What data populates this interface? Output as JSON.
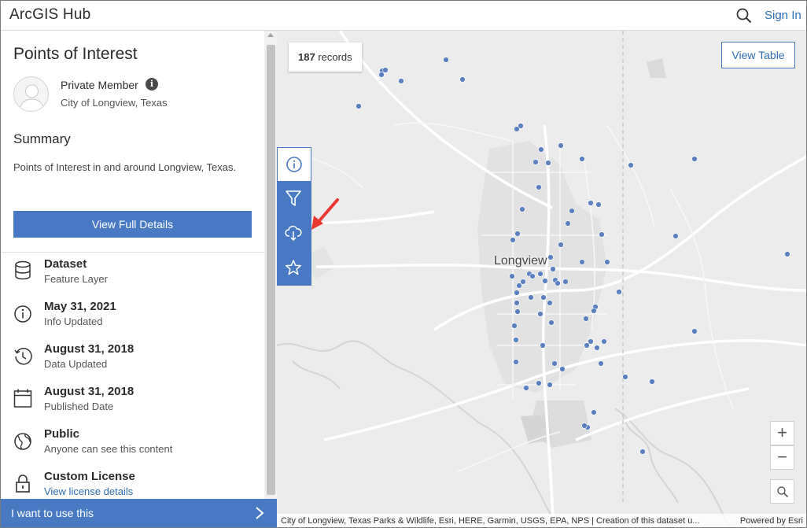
{
  "header": {
    "app_title": "ArcGIS Hub",
    "search_icon": "search-icon",
    "signin_label": "Sign In"
  },
  "panel": {
    "title": "Points of Interest",
    "owner": {
      "name": "Private Member",
      "organization": "City of Longview, Texas"
    },
    "summary_heading": "Summary",
    "summary_text": "Points of Interest in and around Longview, Texas.",
    "view_details_label": "View Full Details",
    "meta": [
      {
        "icon": "database-icon",
        "title": "Dataset",
        "subtitle": "Feature Layer"
      },
      {
        "icon": "info-circle-icon",
        "title": "May 31, 2021",
        "subtitle": "Info Updated"
      },
      {
        "icon": "history-icon",
        "title": "August 31, 2018",
        "subtitle": "Data Updated"
      },
      {
        "icon": "calendar-icon",
        "title": "August 31, 2018",
        "subtitle": "Published Date"
      },
      {
        "icon": "globe-icon",
        "title": "Public",
        "subtitle": "Anyone can see this content"
      },
      {
        "icon": "lock-icon",
        "title": "Custom License",
        "subtitle": "View license details"
      }
    ],
    "use_bar_label": "I want to use this"
  },
  "map": {
    "records_count": "187",
    "records_suffix": " records",
    "view_table_label": "View Table",
    "city_label": "Longview",
    "zoom_in_label": "+",
    "zoom_out_label": "−",
    "attribution": "City of Longview, Texas Parks & Wildlife, Esri, HERE, Garmin, USGS, EPA, NPS | Creation of this dataset u...",
    "powered_by": "Powered by Esri",
    "point_color": "#5a80c2",
    "toolbar": [
      "info-icon",
      "filter-icon",
      "download-icon",
      "star-icon"
    ]
  },
  "colors": {
    "accent": "#4a79c4",
    "link": "#2d6db5",
    "annotation": "#e8382f"
  }
}
